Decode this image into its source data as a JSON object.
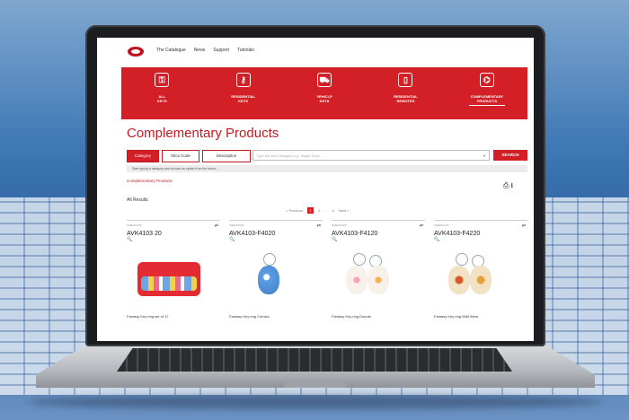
{
  "nav": {
    "links": [
      "The Catalogue",
      "News",
      "Support",
      "Tutorials"
    ]
  },
  "categories": [
    {
      "label_1": "ALL",
      "label_2": "KEYS",
      "icon": "keys-icon"
    },
    {
      "label_1": "RESIDENTIAL",
      "label_2": "KEYS",
      "icon": "key-icon"
    },
    {
      "label_1": "VEHICLE",
      "label_2": "KEYS",
      "icon": "car-icon"
    },
    {
      "label_1": "RESIDENTIAL",
      "label_2": "REMOTES",
      "icon": "remote-icon"
    },
    {
      "label_1": "COMPLEMENTARY",
      "label_2": "PRODUCTS",
      "icon": "accessory-icon"
    }
  ],
  "page": {
    "title": "Complementary Products",
    "breadcrumb": "Complementary Products",
    "results_label": "All Results"
  },
  "filters": {
    "category": "Category",
    "silca_code": "Silca Code",
    "description": "Description",
    "search_placeholder": "Type the item category e.g. Single Keys",
    "search_button": "SEARCH",
    "hint": "Start typing a category and choose an option from the menu..."
  },
  "pagination": {
    "previous": "< Previous",
    "current": "1",
    "next_page": "2",
    "ellipsis": "...",
    "last": "4",
    "next": "Next >"
  },
  "products": [
    {
      "meta": "CHECKOUT",
      "code": "AVK4103    20",
      "name": "Fantasy Key ring set of 17"
    },
    {
      "meta": "CHECKOUT",
      "code": "AVK4103-F4020",
      "name": "Fantasy Key ring Comics"
    },
    {
      "meta": "CHECKOUT",
      "code": "AVK4103-F4120",
      "name": "Fantasy Key ring Donuts"
    },
    {
      "meta": "CHECKOUT",
      "code": "AVK4103-F4220",
      "name": "Fantasy Key ring Wild West"
    }
  ],
  "colors": {
    "accent": "#d31f26"
  }
}
